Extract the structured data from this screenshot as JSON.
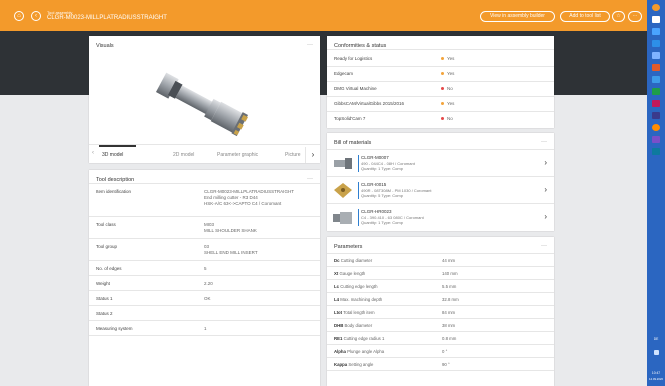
{
  "header": {
    "subtitle": "Tool assembly",
    "title": "CLGR-M0023-MILLPLATRADIUSSTRAIGHT",
    "view_builder": "View in assembly builder",
    "add_tool_list": "Add to tool list",
    "star": "☆",
    "more": "···",
    "home": "⌂",
    "back": "‹"
  },
  "visuals": {
    "title": "Visuals",
    "more": "···",
    "tabs": [
      "3D model",
      "2D model",
      "Parameter graphic",
      "Picture"
    ],
    "prev": "‹",
    "next": "›"
  },
  "conformities": {
    "title": "Conformities & status",
    "rows": [
      {
        "label": "Ready for Logistics",
        "value": "Yes",
        "color": "#f3a33a"
      },
      {
        "label": "Edgecam",
        "value": "Yes",
        "color": "#f3a33a"
      },
      {
        "label": "DMG Virtual Machine",
        "value": "No",
        "color": "#e54848"
      },
      {
        "label": "GibbsCAM/VirtualGibbs 2015/2016",
        "value": "Yes",
        "color": "#f3a33a"
      },
      {
        "label": "TopSolid'Cam 7",
        "value": "No",
        "color": "#e54848"
      }
    ]
  },
  "description": {
    "title": "Tool description",
    "more": "···",
    "rows": [
      {
        "label": "Item identification",
        "lines": [
          "CLGR-M0023-MILLPLATRADIUSSTRAIGHT",
          "End milling cutter - R3 D44",
          "HSK-A/C 63<->CAPTO C4 / Coromant"
        ]
      },
      {
        "label": "Tool class",
        "lines": [
          "MI03",
          "MILL SHOULDER SHANK"
        ]
      },
      {
        "label": "Tool group",
        "lines": [
          "03",
          "SHELL END MILL INSERT"
        ]
      },
      {
        "label": "No. of edges",
        "lines": [
          "5"
        ]
      },
      {
        "label": "Weight",
        "lines": [
          "2.20"
        ]
      },
      {
        "label": "Status 1",
        "lines": [
          "OK"
        ]
      },
      {
        "label": "Status 2",
        "lines": [
          ""
        ]
      },
      {
        "label": "Measuring system",
        "lines": [
          "1"
        ]
      }
    ]
  },
  "bom": {
    "title": "Bill of materials",
    "more": "···",
    "items": [
      {
        "code": "CLGR-M0007",
        "desc": "490 - 044C4 - 08H / Coromant",
        "qty": "Quantity: 1   Type: Comp"
      },
      {
        "code": "CLGR-I0015",
        "desc": "490R - 08T308M - PM 1030 / Coromant",
        "qty": "Quantity: 5   Type: Comp"
      },
      {
        "code": "CLGR-HR0023",
        "desc": "C4 - 390.410 - 63 080C / Coromant",
        "qty": "Quantity: 1   Type: Comp"
      }
    ]
  },
  "parameters": {
    "title": "Parameters",
    "more": "···",
    "rows": [
      {
        "sym": "Dc",
        "label": "Cutting diameter",
        "value": "44 mm"
      },
      {
        "sym": "Xt",
        "label": "Gauge length",
        "value": "140 mm"
      },
      {
        "sym": "Lc",
        "label": "Cutting edge length",
        "value": "5.5 mm"
      },
      {
        "sym": "L4",
        "label": "Max. machining depth",
        "value": "32.8 mm"
      },
      {
        "sym": "Ltot",
        "label": "Total length item",
        "value": "84 mm"
      },
      {
        "sym": "DHB",
        "label": "Body diameter",
        "value": "38 mm"
      },
      {
        "sym": "RE1",
        "label": "Cutting edge radius 1",
        "value": "0.8 mm"
      },
      {
        "sym": "Alpha",
        "label": "Plunge angle Alpha",
        "value": "0 °"
      },
      {
        "sym": "Kappa",
        "label": "Setting angle",
        "value": "90 °"
      }
    ]
  },
  "taskbar": {
    "lang": "DE",
    "time": "10:47",
    "date": "14.09.2020"
  }
}
